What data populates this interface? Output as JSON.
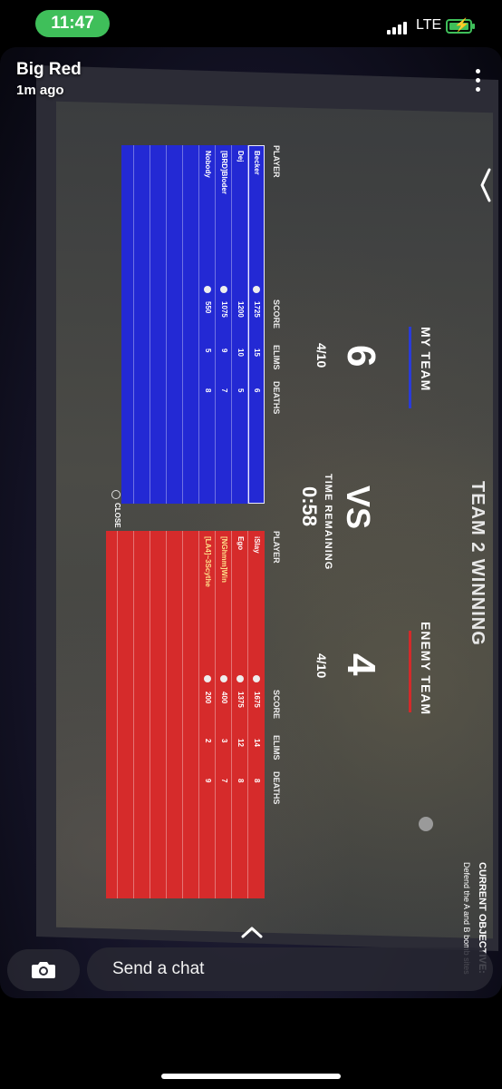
{
  "status": {
    "time": "11:47",
    "network": "LTE"
  },
  "snap": {
    "sender": "Big Red",
    "time_ago": "1m ago"
  },
  "game": {
    "headline": "TEAM 2 WINNING",
    "objective_label": "CURRENT OBJECTIVE:",
    "objective_text": "Defend the A and B bomb sites",
    "my_team_label": "MY TEAM",
    "enemy_team_label": "ENEMY TEAM",
    "my_score": "6",
    "enemy_score": "4",
    "vs": "VS",
    "my_rounds": "4/10",
    "enemy_rounds": "4/10",
    "time_label": "TIME REMAINING",
    "time_value": "0:58",
    "headers": {
      "player": "PLAYER",
      "score": "SCORE",
      "elims": "ELIMS",
      "deaths": "DEATHS"
    },
    "my_players": [
      {
        "name": "Becker",
        "score": "1725",
        "elims": "15",
        "deaths": "6"
      },
      {
        "name": "Dej",
        "score": "1200",
        "elims": "10",
        "deaths": "5"
      },
      {
        "name": "[BRD]Bloder",
        "score": "1075",
        "elims": "9",
        "deaths": "7"
      },
      {
        "name": "Nobody",
        "score": "550",
        "elims": "5",
        "deaths": "8"
      }
    ],
    "enemy_players": [
      {
        "name": "iSlay",
        "score": "1675",
        "elims": "14",
        "deaths": "8"
      },
      {
        "name": "Ego",
        "score": "1375",
        "elims": "12",
        "deaths": "8"
      },
      {
        "name": "[NGhmm]Win",
        "score": "400",
        "elims": "3",
        "deaths": "7"
      },
      {
        "name": "[LA4]~3Scythe",
        "score": "200",
        "elims": "2",
        "deaths": "9"
      }
    ],
    "close_label": "CLOSE"
  },
  "chat": {
    "placeholder": "Send a chat"
  },
  "colors": {
    "my_team": "#2329d4",
    "enemy_team": "#d62b2b",
    "status_green": "#3fbf5a"
  }
}
